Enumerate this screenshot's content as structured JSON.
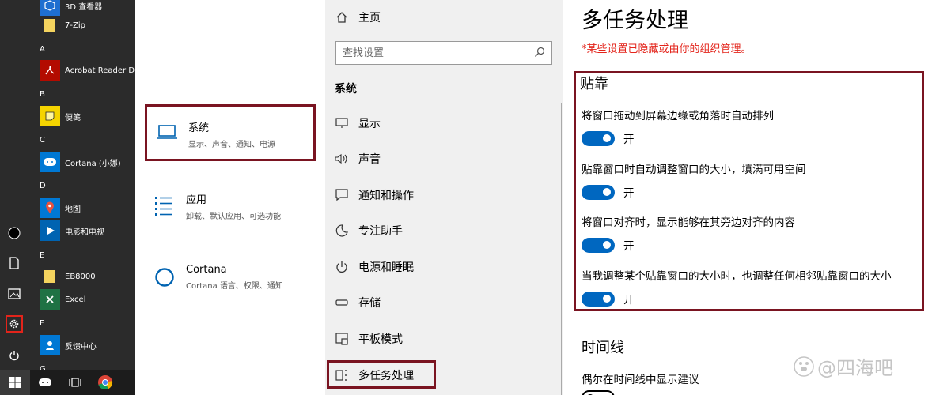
{
  "start_menu": {
    "letters": [
      "A",
      "B",
      "C",
      "D",
      "E",
      "F",
      "G"
    ],
    "apps": [
      {
        "name": "3D 查看器",
        "color": "#1e6fd0"
      },
      {
        "name": "7-Zip",
        "color": "#f4d35e"
      },
      {
        "name": "Acrobat Reader DC",
        "color": "#b30b00"
      },
      {
        "name": "便笺",
        "color": "#f5d400"
      },
      {
        "name": "Cortana (小娜)",
        "color": "#0078d4"
      },
      {
        "name": "地图",
        "color": "#0078d4"
      },
      {
        "name": "电影和电视",
        "color": "#0063b1"
      },
      {
        "name": "EB8000",
        "color": "#f4d35e"
      },
      {
        "name": "Excel",
        "color": "#1f7244"
      },
      {
        "name": "反馈中心",
        "color": "#0078d4"
      }
    ]
  },
  "categories": [
    {
      "title": "系统",
      "subtitle": "显示、声音、通知、电源"
    },
    {
      "title": "应用",
      "subtitle": "卸载、默认应用、可选功能"
    },
    {
      "title": "Cortana",
      "subtitle": "Cortana 语言、权限、通知"
    }
  ],
  "nav": {
    "home": "主页",
    "search_placeholder": "查找设置",
    "section": "系统",
    "items": [
      "显示",
      "声音",
      "通知和操作",
      "专注助手",
      "电源和睡眠",
      "存储",
      "平板模式",
      "多任务处理"
    ]
  },
  "content": {
    "title": "多任务处理",
    "org_note": "*某些设置已隐藏或由你的组织管理。",
    "snap_title": "贴靠",
    "options": [
      {
        "desc": "将窗口拖动到屏幕边缘或角落时自动排列",
        "state": "开"
      },
      {
        "desc": "贴靠窗口时自动调整窗口的大小，填满可用空间",
        "state": "开"
      },
      {
        "desc": "将窗口对齐时，显示能够在其旁边对齐的内容",
        "state": "开"
      },
      {
        "desc": "当我调整某个贴靠窗口的大小时，也调整任何相邻贴靠窗口的大小",
        "state": "开"
      }
    ],
    "timeline_title": "时间线",
    "timeline_desc": "偶尔在时间线中显示建议",
    "watermark": "@四海吧"
  },
  "colors": {
    "accent": "#0067c0",
    "highlight_box": "#7a1421",
    "warning": "#e3241b"
  }
}
